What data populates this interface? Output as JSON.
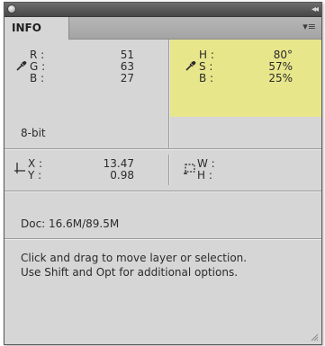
{
  "panel": {
    "tab_label": "INFO",
    "collapse_glyph": "◂◂",
    "menu_glyph": "▾≡"
  },
  "rgb": {
    "labels": [
      "R :",
      "G :",
      "B :"
    ],
    "values": [
      "51",
      "63",
      "27"
    ]
  },
  "hsb": {
    "labels": [
      "H :",
      "S :",
      "B :"
    ],
    "values": [
      "80°",
      "57%",
      "25%"
    ],
    "highlight_color": "#e8e68b"
  },
  "bit_depth": "8-bit",
  "position": {
    "labels": [
      "X :",
      "Y :"
    ],
    "values": [
      "13.47",
      "0.98"
    ]
  },
  "size": {
    "labels": [
      "W :",
      "H :"
    ]
  },
  "doc_info": "Doc: 16.6M/89.5M",
  "hint_lines": [
    "Click and drag to move layer or selection.",
    "Use Shift and Opt for additional options."
  ],
  "icons": {
    "eyedropper": "eyedropper-icon",
    "crosshair": "crosshair-icon",
    "marquee": "marquee-size-icon",
    "close": "close-icon",
    "collapse": "collapse-icon",
    "menu": "panel-menu-icon",
    "resize": "resize-grip-icon"
  }
}
